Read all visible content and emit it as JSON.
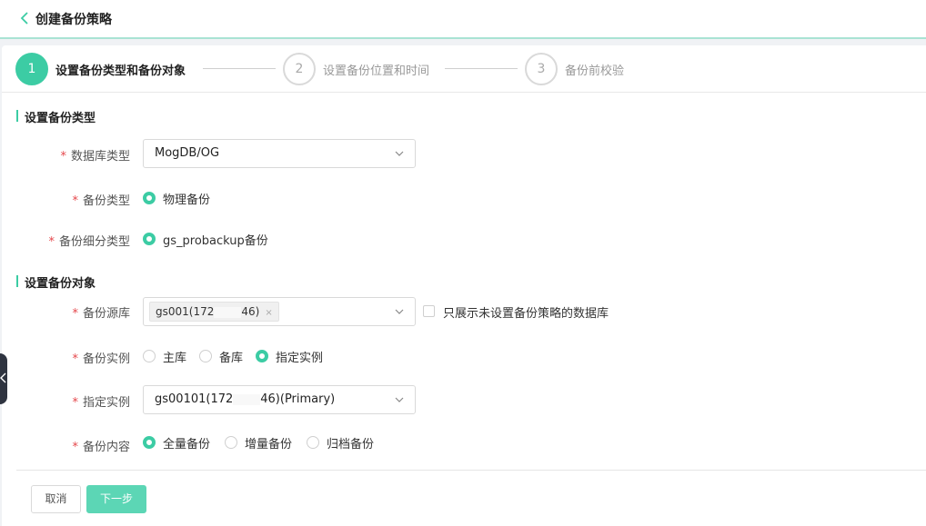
{
  "header": {
    "title": "创建备份策略",
    "back_icon": "chevron-left-icon"
  },
  "steps": [
    {
      "number": "1",
      "label": "设置备份类型和备份对象",
      "state": "active"
    },
    {
      "number": "2",
      "label": "设置备份位置和时间",
      "state": "todo"
    },
    {
      "number": "3",
      "label": "备份前校验",
      "state": "todo"
    }
  ],
  "section_type": {
    "title": "设置备份类型",
    "db_type": {
      "label": "数据库类型",
      "value": "MogDB/OG"
    },
    "backup_type": {
      "label": "备份类型",
      "option": "物理备份"
    },
    "backup_subtype": {
      "label": "备份细分类型",
      "option": "gs_probackup备份"
    }
  },
  "section_object": {
    "title": "设置备份对象",
    "source_db": {
      "label": "备份源库",
      "tag_prefix": "gs001(172",
      "tag_suffix": "46)",
      "checkbox_label": "只展示未设置备份策略的数据库"
    },
    "instance": {
      "label": "备份实例",
      "options": [
        "主库",
        "备库",
        "指定实例"
      ],
      "selected": "指定实例"
    },
    "specified_instance": {
      "label": "指定实例",
      "value_prefix": "gs00101(172",
      "value_suffix": "46)(Primary)"
    },
    "content": {
      "label": "备份内容",
      "options": [
        "全量备份",
        "增量备份",
        "归档备份"
      ],
      "selected": "全量备份"
    }
  },
  "actions": {
    "cancel": "取消",
    "next": "下一步"
  },
  "required_mark": "*",
  "colors": {
    "accent": "#3ccca4",
    "required": "#e5474b"
  }
}
